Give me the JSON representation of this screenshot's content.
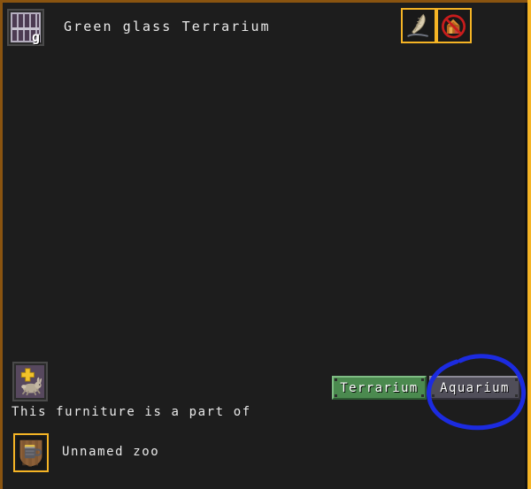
{
  "window": {
    "background_color": "#1d1d1d",
    "frame_color": "#f5b425"
  },
  "header": {
    "title": "Green glass Terrarium",
    "icon_name": "green-glass-window-sprite",
    "icon_letter": "g",
    "actions": [
      {
        "name": "rename-button",
        "icon": "quill-pen-icon",
        "label": ""
      },
      {
        "name": "no-build-button",
        "icon": "no-house-icon",
        "label": ""
      }
    ]
  },
  "zoo_section": {
    "animal_icon_name": "zoo-animal-icon",
    "part_of_text": "This furniture is a part of",
    "zoo_icon_name": "zoo-mug-icon",
    "zoo_name": "Unnamed zoo"
  },
  "tabs": [
    {
      "name": "tab-terrarium",
      "label": "Terrarium",
      "selected": true,
      "color": "#4b8a4f"
    },
    {
      "name": "tab-aquarium",
      "label": "Aquarium",
      "selected": false,
      "color": "#504e59"
    }
  ],
  "annotation": {
    "name": "blue-circle-annotation",
    "color": "#1c2be0",
    "targets": "tab-aquarium"
  }
}
